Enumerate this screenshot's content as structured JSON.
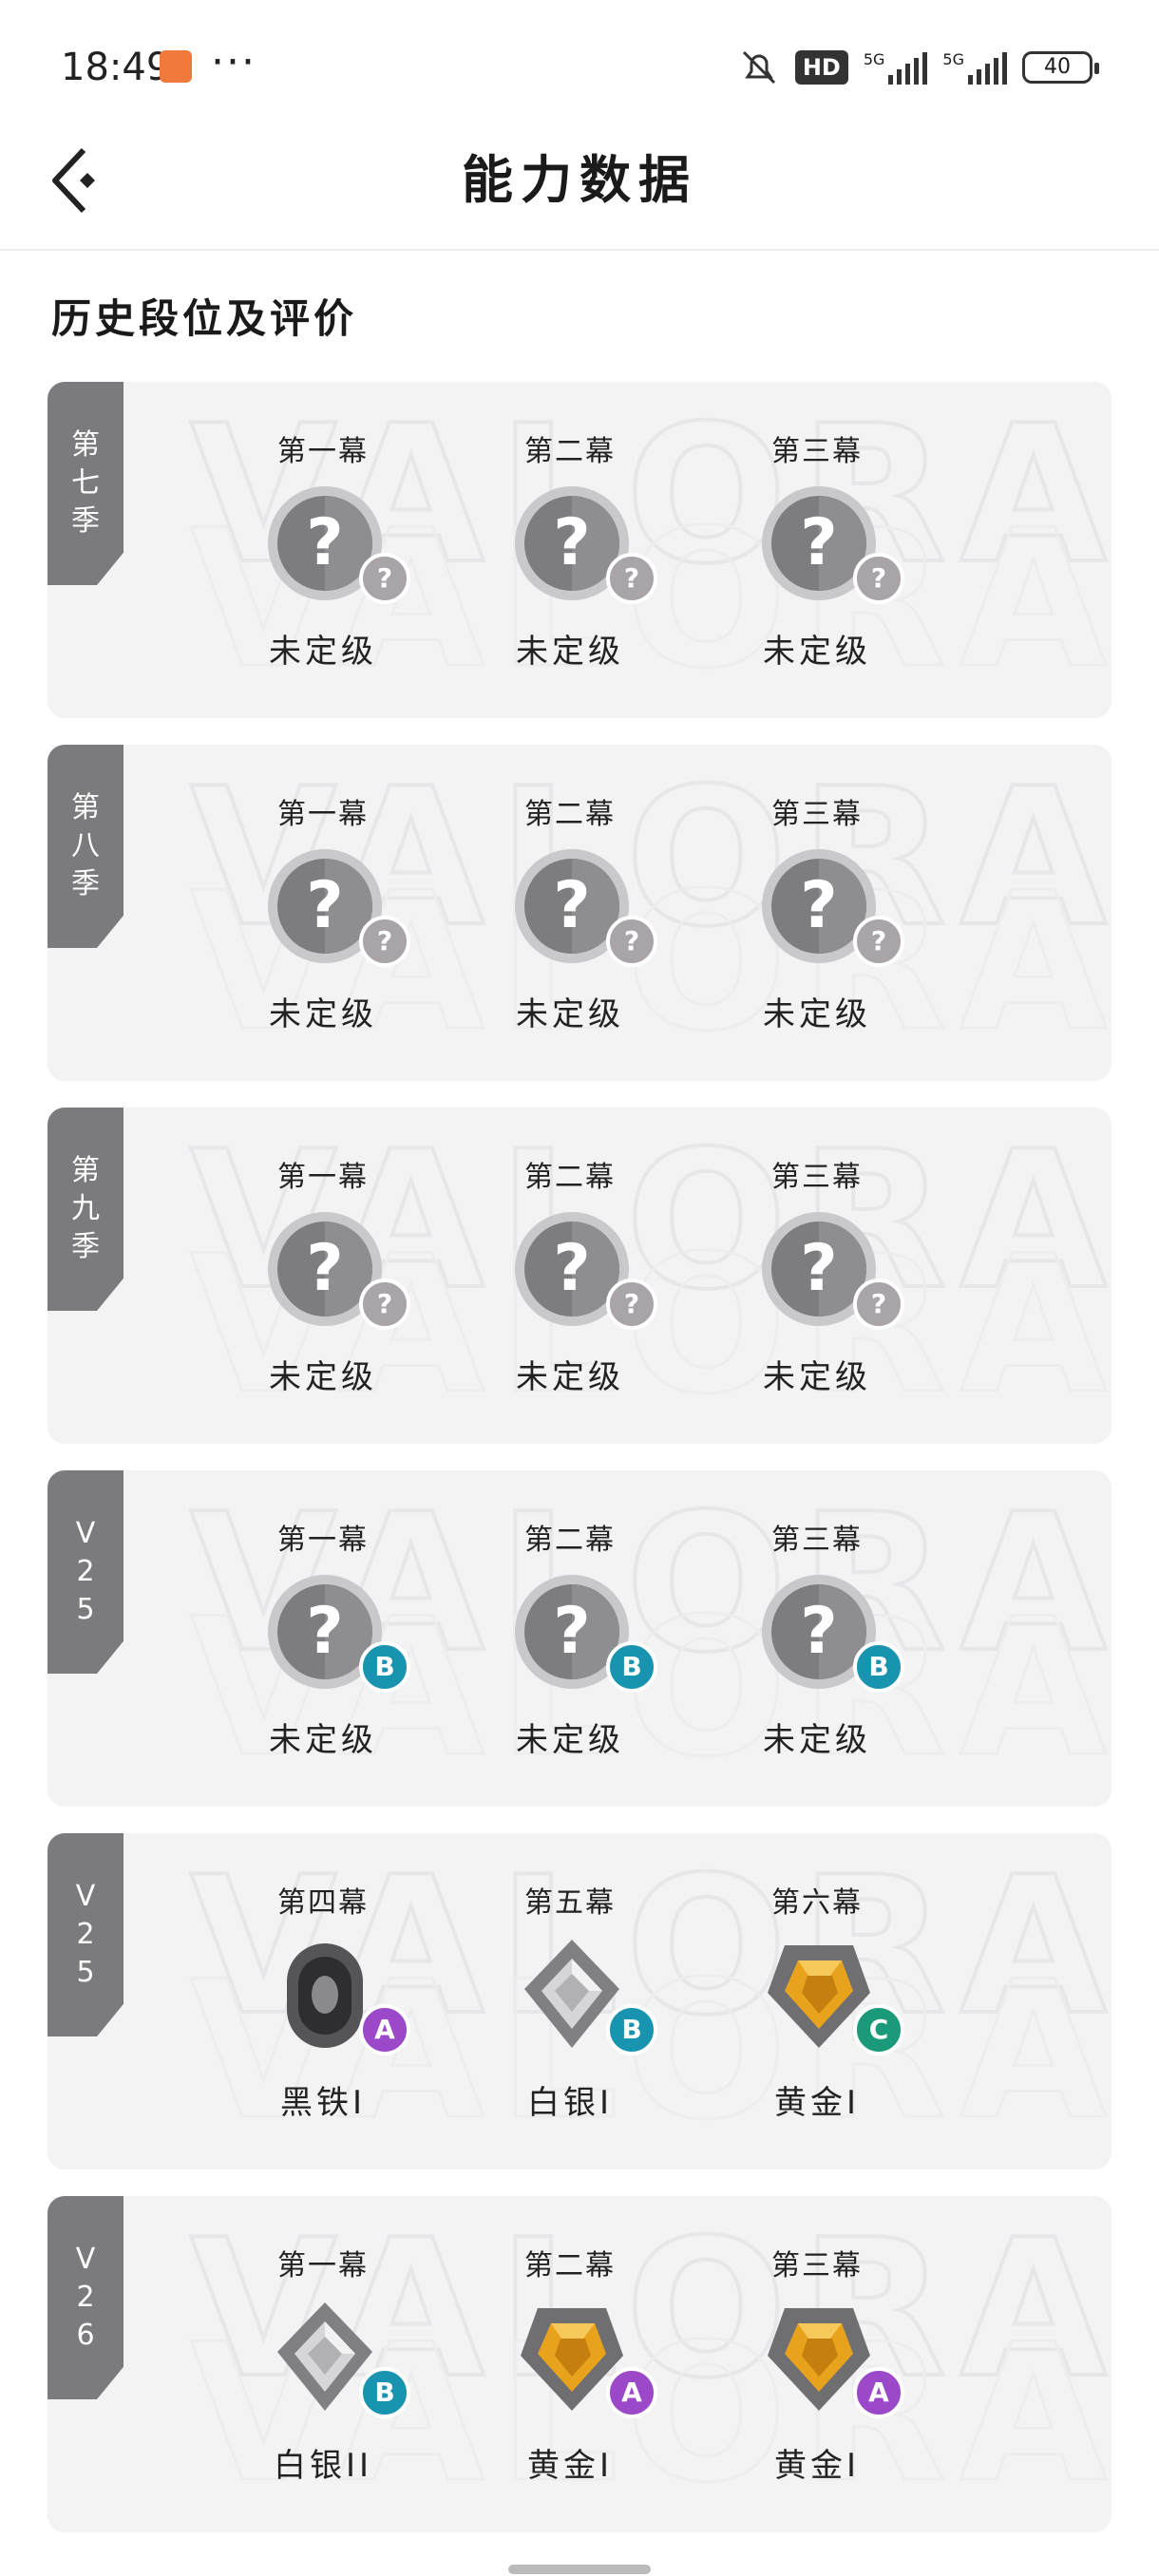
{
  "status_bar": {
    "time": "18:49",
    "dots": "···",
    "hd": "HD",
    "network": "5G",
    "battery": "40"
  },
  "header": {
    "title": "能力数据"
  },
  "section": {
    "title": "历史段位及评价"
  },
  "watermark": "VALORANT",
  "cards": [
    {
      "season": "第七季",
      "acts": [
        {
          "label": "第一幕",
          "rank": "未定级",
          "emblem": "unranked",
          "badge": "?"
        },
        {
          "label": "第二幕",
          "rank": "未定级",
          "emblem": "unranked",
          "badge": "?"
        },
        {
          "label": "第三幕",
          "rank": "未定级",
          "emblem": "unranked",
          "badge": "?"
        }
      ]
    },
    {
      "season": "第八季",
      "acts": [
        {
          "label": "第一幕",
          "rank": "未定级",
          "emblem": "unranked",
          "badge": "?"
        },
        {
          "label": "第二幕",
          "rank": "未定级",
          "emblem": "unranked",
          "badge": "?"
        },
        {
          "label": "第三幕",
          "rank": "未定级",
          "emblem": "unranked",
          "badge": "?"
        }
      ]
    },
    {
      "season": "第九季",
      "acts": [
        {
          "label": "第一幕",
          "rank": "未定级",
          "emblem": "unranked",
          "badge": "?"
        },
        {
          "label": "第二幕",
          "rank": "未定级",
          "emblem": "unranked",
          "badge": "?"
        },
        {
          "label": "第三幕",
          "rank": "未定级",
          "emblem": "unranked",
          "badge": "?"
        }
      ]
    },
    {
      "season": "V25",
      "acts": [
        {
          "label": "第一幕",
          "rank": "未定级",
          "emblem": "unranked",
          "badge": "B"
        },
        {
          "label": "第二幕",
          "rank": "未定级",
          "emblem": "unranked",
          "badge": "B"
        },
        {
          "label": "第三幕",
          "rank": "未定级",
          "emblem": "unranked",
          "badge": "B"
        }
      ]
    },
    {
      "season": "V25",
      "acts": [
        {
          "label": "第四幕",
          "rank": "黑铁I",
          "emblem": "iron",
          "badge": "A"
        },
        {
          "label": "第五幕",
          "rank": "白银I",
          "emblem": "silver",
          "badge": "B"
        },
        {
          "label": "第六幕",
          "rank": "黄金I",
          "emblem": "gold",
          "badge": "C"
        }
      ]
    },
    {
      "season": "V26",
      "acts": [
        {
          "label": "第一幕",
          "rank": "白银II",
          "emblem": "silver",
          "badge": "B"
        },
        {
          "label": "第二幕",
          "rank": "黄金I",
          "emblem": "gold",
          "badge": "A"
        },
        {
          "label": "第三幕",
          "rank": "黄金I",
          "emblem": "gold",
          "badge": "A"
        }
      ]
    }
  ],
  "colors": {
    "tag": "#7b7b7d",
    "card": "#f3f3f4",
    "badge_unranked": "#a9a4a8",
    "badge_a": "#9b48c9",
    "badge_b": "#1994b0",
    "badge_c": "#1a9a78",
    "gold": "#e8a21c",
    "silver": "#b9b9bb",
    "iron": "#3b3b3c"
  }
}
